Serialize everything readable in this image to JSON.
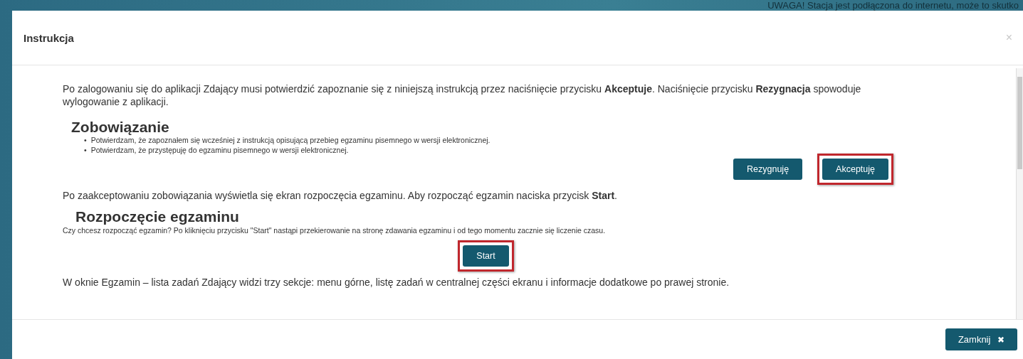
{
  "background_notice": "UWAGA! Stacja jest podłączona do internetu, może to skutko",
  "dialog": {
    "title": "Instrukcja",
    "close_icon": "×",
    "intro": "Po zalogowaniu się do aplikacji Zdający musi potwierdzić zapoznanie się z niniejszą instrukcją przez naciśnięcie przycisku **Akceptuje**. Naciśnięcie przycisku **Rezygnacja** spowoduje wylogowanie z aplikacji.",
    "commitment": {
      "heading": "Zobowiązanie",
      "marker": "•",
      "items": [
        "Potwierdzam, że zapoznałem się wcześniej z instrukcją opisującą przebieg egzaminu pisemnego w wersji elektronicznej.",
        "Potwierdzam, że przystępuję do egzaminu pisemnego w wersji elektronicznej."
      ],
      "buttons": [
        {
          "label": "Rezygnuję",
          "highlighted": false
        },
        {
          "label": "Akceptuję",
          "highlighted": true
        }
      ]
    },
    "after_accept": "Po zaakceptowaniu zobowiązania wyświetla się ekran rozpoczęcia egzaminu. Aby rozpocząć egzamin naciska przycisk **Start**.",
    "start": {
      "heading": "Rozpoczęcie egzaminu",
      "text": "Czy chcesz rozpocząć egzamin? Po kliknięciu przycisku \"Start\" nastąpi przekierowanie na stronę zdawania egzaminu i od tego momentu zacznie się liczenie czasu.",
      "button": {
        "label": "Start",
        "highlighted": true
      }
    },
    "sections_text": "W oknie Egzamin – lista zadań Zdający widzi trzy sekcje: menu górne, listę zadań w centralnej części ekranu i informacje dodatkowe po prawej stronie.",
    "footer_button": {
      "label": "Zamknij",
      "icon": "✖"
    }
  }
}
